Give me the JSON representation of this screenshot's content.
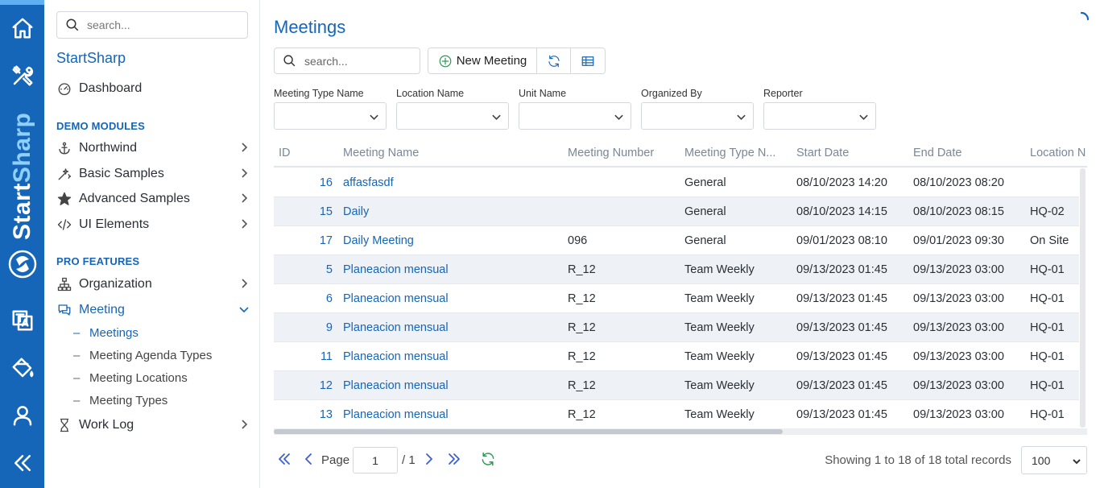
{
  "rail": {
    "brand_part1": "Start",
    "brand_part2": "Sharp",
    "icons": [
      "home-icon",
      "tools-icon",
      "translate-icon",
      "paint-bucket-icon",
      "user-icon",
      "collapse-icon"
    ]
  },
  "sidebar": {
    "search_placeholder": "search...",
    "app_name": "StartSharp",
    "dashboard": "Dashboard",
    "demo_header": "DEMO MODULES",
    "demo_items": [
      "Northwind",
      "Basic Samples",
      "Advanced Samples",
      "UI Elements"
    ],
    "pro_header": "PRO FEATURES",
    "organization": "Organization",
    "meeting": "Meeting",
    "meeting_sub": [
      "Meetings",
      "Meeting Agenda Types",
      "Meeting Locations",
      "Meeting Types"
    ],
    "sub_dash": "–",
    "work_log": "Work Log"
  },
  "page": {
    "title": "Meetings",
    "search_placeholder": "search...",
    "new_button": "New Meeting"
  },
  "filters": [
    "Meeting Type Name",
    "Location Name",
    "Unit Name",
    "Organized By",
    "Reporter"
  ],
  "grid": {
    "columns": [
      "ID",
      "Meeting Name",
      "Meeting Number",
      "Meeting Type N...",
      "Start Date",
      "End Date",
      "Location N"
    ],
    "rows": [
      {
        "id": "16",
        "name": "affasfasdf",
        "number": "",
        "type": "General",
        "start": "08/10/2023 14:20",
        "end": "08/10/2023 08:20",
        "location": ""
      },
      {
        "id": "15",
        "name": "Daily",
        "number": "",
        "type": "General",
        "start": "08/10/2023 14:15",
        "end": "08/10/2023 08:15",
        "location": "HQ-02"
      },
      {
        "id": "17",
        "name": "Daily Meeting",
        "number": "096",
        "type": "General",
        "start": "09/01/2023 08:10",
        "end": "09/01/2023 09:30",
        "location": "On Site"
      },
      {
        "id": "5",
        "name": "Planeacion mensual",
        "number": "R_12",
        "type": "Team Weekly",
        "start": "09/13/2023 01:45",
        "end": "09/13/2023 03:00",
        "location": "HQ-01"
      },
      {
        "id": "6",
        "name": "Planeacion mensual",
        "number": "R_12",
        "type": "Team Weekly",
        "start": "09/13/2023 01:45",
        "end": "09/13/2023 03:00",
        "location": "HQ-01"
      },
      {
        "id": "9",
        "name": "Planeacion mensual",
        "number": "R_12",
        "type": "Team Weekly",
        "start": "09/13/2023 01:45",
        "end": "09/13/2023 03:00",
        "location": "HQ-01"
      },
      {
        "id": "11",
        "name": "Planeacion mensual",
        "number": "R_12",
        "type": "Team Weekly",
        "start": "09/13/2023 01:45",
        "end": "09/13/2023 03:00",
        "location": "HQ-01"
      },
      {
        "id": "12",
        "name": "Planeacion mensual",
        "number": "R_12",
        "type": "Team Weekly",
        "start": "09/13/2023 01:45",
        "end": "09/13/2023 03:00",
        "location": "HQ-01"
      },
      {
        "id": "13",
        "name": "Planeacion mensual",
        "number": "R_12",
        "type": "Team Weekly",
        "start": "09/13/2023 01:45",
        "end": "09/13/2023 03:00",
        "location": "HQ-01"
      }
    ]
  },
  "pager": {
    "page_label": "Page",
    "page_value": "1",
    "page_total": "/ 1",
    "status": "Showing 1 to 18 of 18 total records",
    "page_size": "100"
  },
  "colors": {
    "primary": "#1566b8",
    "rail_accent": "#8fd0ff",
    "add_green": "#2e9a55",
    "pager_blue": "#3b5fd6"
  }
}
